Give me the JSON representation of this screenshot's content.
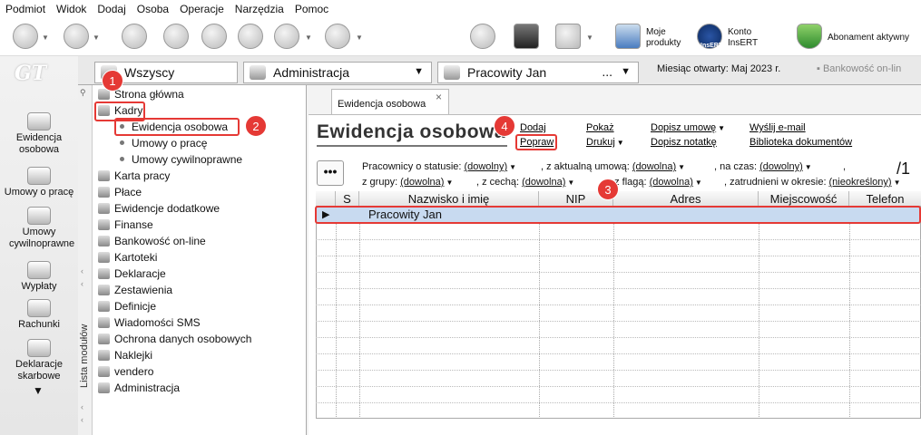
{
  "menu": [
    "Podmiot",
    "Widok",
    "Dodaj",
    "Osoba",
    "Operacje",
    "Narzędzia",
    "Pomoc"
  ],
  "toolbar": {
    "products": "Moje produkty",
    "account": "Konto InsERT",
    "account_brand": "InsERT",
    "subscription": "Abonament aktywny"
  },
  "header": {
    "group": "Wszyscy",
    "department": "Administracja",
    "employee": "Pracowity Jan",
    "employee_ellipsis": "...",
    "month_label": "Miesiąc otwarty: Maj 2023 r.",
    "bank": "Bankowość on-lin"
  },
  "leftbar": {
    "logo": "GT",
    "items": [
      "Ewidencja osobowa",
      "Umowy o pracę",
      "Umowy cywilnoprawne",
      "Wypłaty",
      "Rachunki",
      "Deklaracje skarbowe"
    ]
  },
  "modules": {
    "label": "Lista modułów",
    "items": [
      "Strona główna",
      "Kadry",
      "Karta pracy",
      "Płace",
      "Ewidencje dodatkowe",
      "Finanse",
      "Bankowość on-line",
      "Kartoteki",
      "Deklaracje",
      "Zestawienia",
      "Definicje",
      "Wiadomości SMS",
      "Ochrona danych osobowych",
      "Naklejki",
      "vendero",
      "Administracja"
    ],
    "kadry_sub": [
      "Ewidencja osobowa",
      "Umowy o pracę",
      "Umowy cywilnoprawne"
    ]
  },
  "tab": {
    "label": "Ewidencja osobowa",
    "close": "×"
  },
  "main": {
    "title": "Ewidencja osobowa",
    "actions": {
      "dodaj": "Dodaj",
      "popraw": "Popraw",
      "pokaz": "Pokaż",
      "drukuj": "Drukuj",
      "dopisz_umowe": "Dopisz umowę",
      "dopisz_notatke": "Dopisz notatkę",
      "wyslij": "Wyślij e-mail",
      "biblioteka": "Biblioteka dokumentów"
    },
    "more": "•••",
    "counter": "/1",
    "filters": {
      "status_label": "Pracownicy o statusie:",
      "status": "(dowolny)",
      "umowa_label": ", z aktualną umową:",
      "umowa": "(dowolna)",
      "czas_label": ", na czas:",
      "czas": "(dowolny)",
      "comma": ",",
      "grupa_label": "z grupy:",
      "grupa": "(dowolna)",
      "cecha_label": ", z cechą:",
      "cecha": "(dowolna)",
      "flaga_label": ", z flagą:",
      "flaga": "(dowolna)",
      "okres_label": ", zatrudnieni w okresie:",
      "okres": "(nieokreślony)"
    }
  },
  "table": {
    "columns": [
      "S",
      "Nazwisko i imię",
      "NIP",
      "Adres",
      "Miejscowość",
      "Telefon"
    ],
    "rows": [
      {
        "name": "Pracowity Jan"
      }
    ],
    "pointer": "▶"
  },
  "callouts": [
    "1",
    "2",
    "3",
    "4"
  ],
  "colors": {
    "accent": "#e53935",
    "selection": "#c8daf0"
  }
}
